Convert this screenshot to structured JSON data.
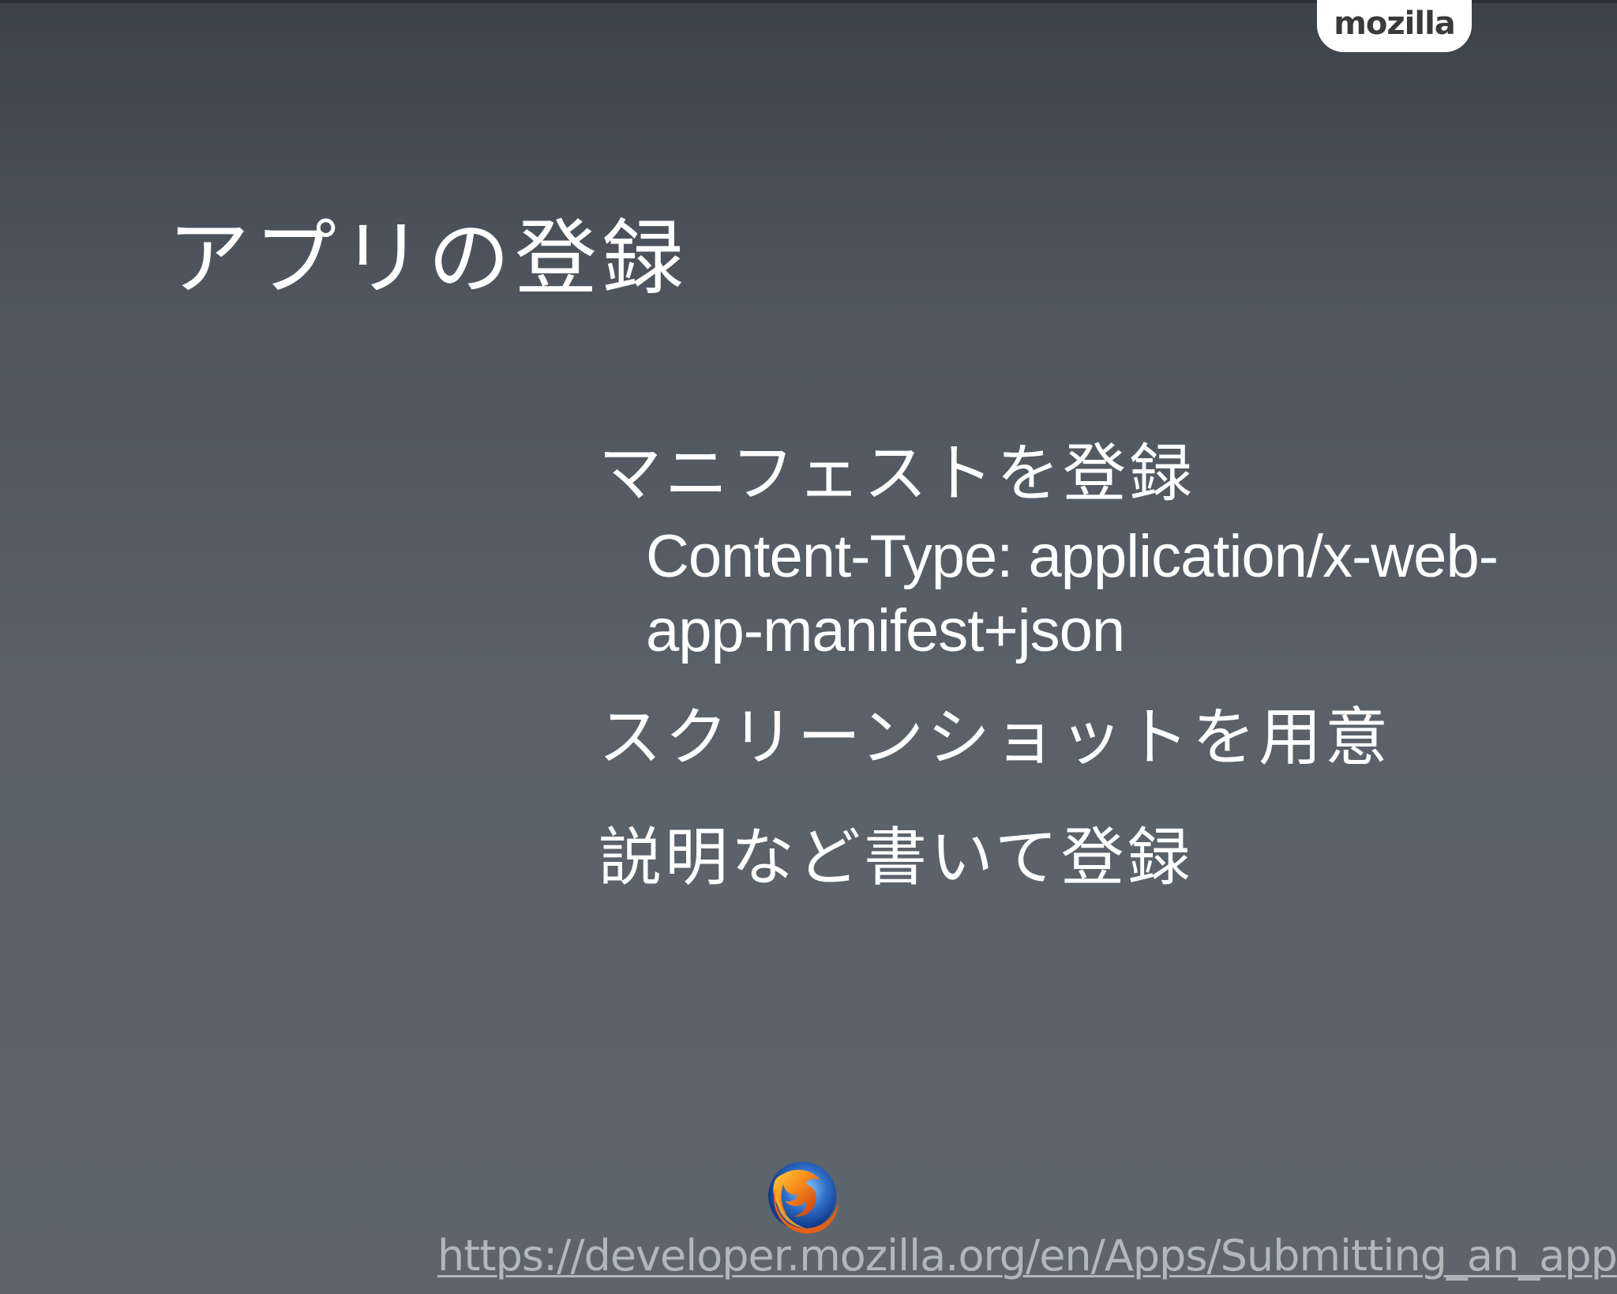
{
  "brand": {
    "tab_label": "mozilla"
  },
  "slide": {
    "title": "アプリの登録",
    "bullets": [
      {
        "text": "マニフェストを登録"
      },
      {
        "text": "スクリーンショットを用意"
      },
      {
        "text": "説明など書いて登録"
      }
    ],
    "sub_bullet": {
      "line1": "Content-Type: application/x-web-",
      "line2": "app-manifest+json"
    },
    "url": "https://developer.mozilla.org/en/Apps/Submitting_an_app"
  },
  "icons": {
    "logo": "firefox-logo-icon"
  },
  "colors": {
    "background": "#5a6169",
    "text": "#ffffff",
    "url": "#b3b6ba"
  }
}
